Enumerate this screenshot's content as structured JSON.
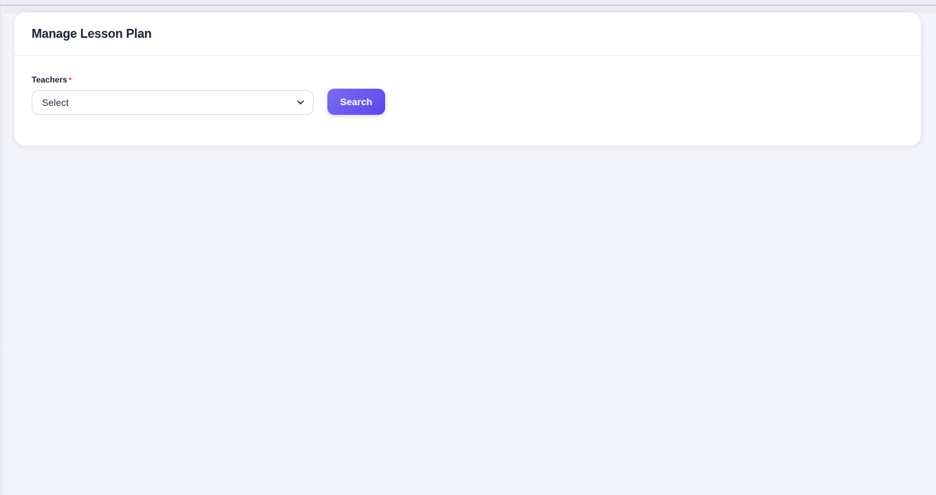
{
  "card": {
    "title": "Manage Lesson Plan"
  },
  "form": {
    "teachers_label": "Teachers",
    "required_marker": "*",
    "teachers_select_value": "Select",
    "search_label": "Search"
  },
  "icons": {
    "select_chevron": "chevron-down-icon"
  },
  "colors": {
    "accent": "#6a58ee",
    "required": "#e5364d",
    "title_text": "#1a2237",
    "background": "#f4f5fa"
  }
}
